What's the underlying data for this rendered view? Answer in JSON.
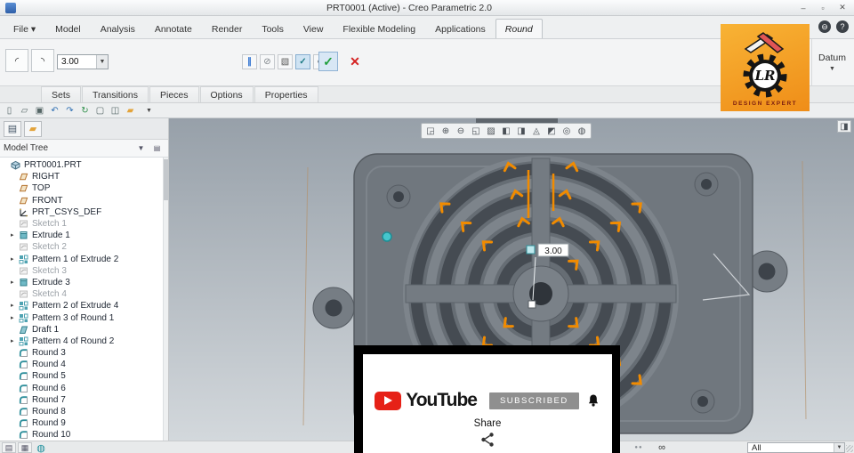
{
  "window": {
    "title": "PRT0001 (Active) - Creo Parametric 2.0",
    "controls": [
      "minimize-icon",
      "maximize-icon",
      "close-icon"
    ]
  },
  "ribbon": {
    "tabs": [
      {
        "label": "File",
        "arrow": true
      },
      {
        "label": "Model"
      },
      {
        "label": "Analysis"
      },
      {
        "label": "Annotate"
      },
      {
        "label": "Render"
      },
      {
        "label": "Tools"
      },
      {
        "label": "View"
      },
      {
        "label": "Flexible Modeling"
      },
      {
        "label": "Applications"
      },
      {
        "label": "Round",
        "active": true
      }
    ],
    "help_icons": [
      "minimize-ribbon-icon",
      "help-icon"
    ],
    "quick_access_icons": [
      "new-file-icon",
      "open-icon",
      "save-icon",
      "undo-icon",
      "redo-icon",
      "regenerate-icon",
      "close-window-icon",
      "windows-icon",
      "folder-icon",
      "more-icon"
    ],
    "round_tab": {
      "set_mode_icons": [
        "round-sets-icon",
        "round-transitions-icon"
      ],
      "radius_value": "3.00",
      "tool_icons": [
        "pause-icon",
        "remove-set-icon",
        "preview-detached-icon",
        "preview-attached-icon",
        "verify-icon"
      ],
      "ok_icon": "ok-check-icon",
      "cancel_icon": "cancel-x-icon",
      "datum_group_label": "Datum"
    },
    "subtabs": [
      "Sets",
      "Transitions",
      "Pieces",
      "Options",
      "Properties"
    ]
  },
  "left_panel": {
    "tab_icons": [
      "model-tree-tab-icon",
      "folder-browser-tab-icon"
    ],
    "tree_header": {
      "title": "Model Tree",
      "icons": [
        "filter-icon",
        "settings-list-icon"
      ]
    }
  },
  "model_tree": {
    "items": [
      {
        "label": "PRT0001.PRT",
        "icon": "part",
        "root": true
      },
      {
        "label": "RIGHT",
        "icon": "datum-plane"
      },
      {
        "label": "TOP",
        "icon": "datum-plane"
      },
      {
        "label": "FRONT",
        "icon": "datum-plane"
      },
      {
        "label": "PRT_CSYS_DEF",
        "icon": "csys"
      },
      {
        "label": "Sketch 1",
        "icon": "sketch",
        "suppressed": true
      },
      {
        "label": "Extrude 1",
        "icon": "extrude",
        "expandable": true
      },
      {
        "label": "Sketch 2",
        "icon": "sketch",
        "suppressed": true
      },
      {
        "label": "Pattern 1 of Extrude 2",
        "icon": "pattern",
        "expandable": true
      },
      {
        "label": "Sketch 3",
        "icon": "sketch",
        "suppressed": true
      },
      {
        "label": "Extrude 3",
        "icon": "extrude",
        "expandable": true
      },
      {
        "label": "Sketch 4",
        "icon": "sketch",
        "suppressed": true
      },
      {
        "label": "Pattern 2 of Extrude 4",
        "icon": "pattern",
        "expandable": true
      },
      {
        "label": "Pattern 3 of Round 1",
        "icon": "pattern",
        "expandable": true
      },
      {
        "label": "Draft 1",
        "icon": "draft"
      },
      {
        "label": "Pattern 4 of Round 2",
        "icon": "pattern",
        "expandable": true
      },
      {
        "label": "Round 3",
        "icon": "round"
      },
      {
        "label": "Round 4",
        "icon": "round"
      },
      {
        "label": "Round 5",
        "icon": "round"
      },
      {
        "label": "Round 6",
        "icon": "round"
      },
      {
        "label": "Round 7",
        "icon": "round"
      },
      {
        "label": "Round 8",
        "icon": "round"
      },
      {
        "label": "Round 9",
        "icon": "round"
      },
      {
        "label": "Round 10",
        "icon": "round"
      }
    ]
  },
  "viewport": {
    "toolbar_icons": [
      "zoom-window-icon",
      "zoom-in-icon",
      "zoom-out-icon",
      "refit-icon",
      "repaint-icon",
      "display-style-icon",
      "saved-views-icon",
      "datum-display-icon",
      "annotation-display-icon",
      "spin-center-icon",
      "view-manager-icon"
    ],
    "side_icons": [
      "panel-toggle-icon"
    ],
    "dimension_label": "3.00"
  },
  "statusbar": {
    "left_icons": [
      "model-tree-toggle-icon",
      "browser-toggle-icon",
      "web-icon"
    ],
    "center_icons": [
      "selection-dots-icon",
      "search-binoculars-icon"
    ],
    "filter_label": "All"
  },
  "overlays": {
    "logo": {
      "monogram": "LR",
      "tagline": "DESIGN EXPERT"
    },
    "youtube": {
      "brand": "YouTube",
      "subscribed_label": "SUBSCRIBED",
      "share_label": "Share"
    }
  },
  "colors": {
    "highlight_orange": "#f18b00",
    "accent_teal": "#45c6cc",
    "youtube_red": "#e62117",
    "logo_orange": "#f5a11c"
  }
}
